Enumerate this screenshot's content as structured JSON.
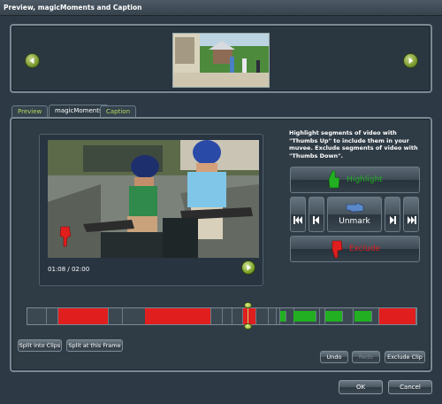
{
  "window": {
    "title": "Preview, magicMoments and Caption"
  },
  "tabs": [
    {
      "label": "Preview",
      "active": false
    },
    {
      "label": "magicMoments",
      "active": true
    },
    {
      "label": "Caption",
      "active": false
    }
  ],
  "player": {
    "timecode": "01:08 / 02:00"
  },
  "instructions": "Highlight segments of video with \"Thumbs Up\" to include them in your muvee. Exclude segments of video with \"Thumbs Down\".",
  "controls": {
    "highlight_label": "Highlight",
    "unmark_label": "Unmark",
    "exclude_label": "Exclude"
  },
  "colors": {
    "highlight": "#22b022",
    "exclude": "#e11e1e",
    "accent_green": "#b6d85e",
    "panel_bg": "#2f3c46"
  },
  "timeline": {
    "segments": [
      {
        "start": 0.0,
        "end": 0.05,
        "mark": "none"
      },
      {
        "start": 0.05,
        "end": 0.08,
        "mark": "none"
      },
      {
        "start": 0.08,
        "end": 0.21,
        "mark": "exclude"
      },
      {
        "start": 0.21,
        "end": 0.247,
        "mark": "none"
      },
      {
        "start": 0.247,
        "end": 0.303,
        "mark": "none"
      },
      {
        "start": 0.303,
        "end": 0.473,
        "mark": "exclude"
      },
      {
        "start": 0.473,
        "end": 0.502,
        "mark": "none"
      },
      {
        "start": 0.502,
        "end": 0.527,
        "mark": "none"
      },
      {
        "start": 0.527,
        "end": 0.555,
        "mark": "none"
      },
      {
        "start": 0.555,
        "end": 0.59,
        "mark": "exclude"
      },
      {
        "start": 0.59,
        "end": 0.62,
        "mark": "none"
      },
      {
        "start": 0.62,
        "end": 0.64,
        "mark": "none"
      },
      {
        "start": 0.64,
        "end": 0.65,
        "mark": "none"
      },
      {
        "start": 0.65,
        "end": 0.665,
        "mark": "highlight"
      },
      {
        "start": 0.665,
        "end": 0.685,
        "mark": "none"
      },
      {
        "start": 0.685,
        "end": 0.745,
        "mark": "highlight"
      },
      {
        "start": 0.745,
        "end": 0.752,
        "mark": "none"
      },
      {
        "start": 0.752,
        "end": 0.765,
        "mark": "none"
      },
      {
        "start": 0.765,
        "end": 0.81,
        "mark": "highlight"
      },
      {
        "start": 0.81,
        "end": 0.84,
        "mark": "none"
      },
      {
        "start": 0.84,
        "end": 0.885,
        "mark": "highlight"
      },
      {
        "start": 0.885,
        "end": 0.905,
        "mark": "none"
      },
      {
        "start": 0.905,
        "end": 1.0,
        "mark": "exclude"
      }
    ],
    "playhead_fraction": 0.567
  },
  "buttons": {
    "split_into_clips": "Split into Clips",
    "split_at_frame": "Split at this Frame",
    "undo": "Undo",
    "redo": "Redo",
    "exclude_clip": "Exclude Clip",
    "ok": "OK",
    "cancel": "Cancel"
  }
}
